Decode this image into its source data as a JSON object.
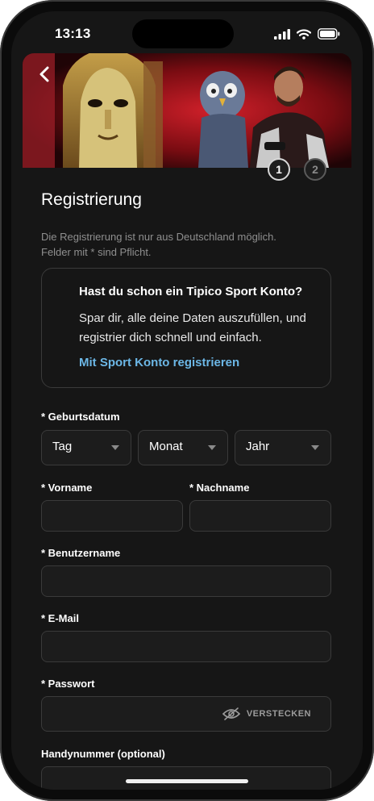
{
  "status_bar": {
    "time": "13:13"
  },
  "steps": [
    "1",
    "2"
  ],
  "page": {
    "title": "Registrierung",
    "subtitle": "Die Registrierung ist nur aus Deutschland möglich. Felder mit * sind Pflicht."
  },
  "sport_card": {
    "title": "Hast du schon ein Tipico Sport Konto?",
    "text": "Spar dir, alle deine Daten auszufüllen, und registrier dich schnell und einfach.",
    "link": "Mit Sport Konto registrieren"
  },
  "form": {
    "birthdate_label": "* Geburtsdatum",
    "day": "Tag",
    "month": "Monat",
    "year": "Jahr",
    "firstname_label": "* Vorname",
    "lastname_label": "* Nachname",
    "username_label": "* Benutzername",
    "email_label": "* E-Mail",
    "password_label": "* Passwort",
    "password_toggle": "VERSTECKEN",
    "phone_label": "Handynummer (optional)"
  },
  "colors": {
    "accent_link": "#6cb7e6",
    "background": "#161616",
    "border": "#3a3a3a"
  }
}
